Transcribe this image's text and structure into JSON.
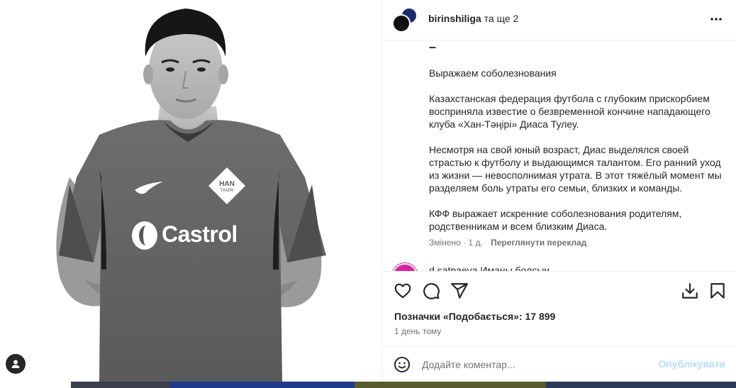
{
  "header": {
    "username": "birinshiliga",
    "others": "та ще 2",
    "more_icon": "more-horizontal-icon"
  },
  "caption": {
    "dash": "–",
    "lines": [
      "Выражаем соболезнования",
      "Казахстанская федерация футбола с глубоким прискорбием восприняла известие о безвременной кончине нападающего клуба «Хан-Тәңірі» Диаса Тулеу.",
      "Несмотря на свой юный возраст, Диас выделялся своей страстью к футболу и выдающимся талантом. Его ранний уход из жизни — невосполнимая утрата. В этот тяжёлый момент мы разделяем боль утраты его семьи, близких и команды.",
      "КФФ выражает искренние соболезнования родителям, родственникам и всем близким Диаса."
    ],
    "meta": "Змінено · 1 д.",
    "translate": "Переглянути переклад"
  },
  "comment_preview": "d.satpaeva Иманы болсын",
  "actions": {
    "like_icon": "heart-icon",
    "comment_icon": "comment-icon",
    "share_icon": "send-icon",
    "download_icon": "download-icon",
    "save_icon": "bookmark-icon"
  },
  "likes": "Позначки «Подобається»: 17 899",
  "time_ago": "1 день тому",
  "compose": {
    "placeholder": "Додайте коментар...",
    "post_label": "Опублікувати",
    "emoji_icon": "smiley-icon"
  },
  "media": {
    "jersey_sponsor": "Castrol",
    "badge": "HAN",
    "badge_sub": "TANIRI",
    "user_tag_icon": "user-tag-icon"
  },
  "colors": {
    "link_disabled": "#b3dbff",
    "muted": "#737373",
    "border": "#efefef"
  }
}
